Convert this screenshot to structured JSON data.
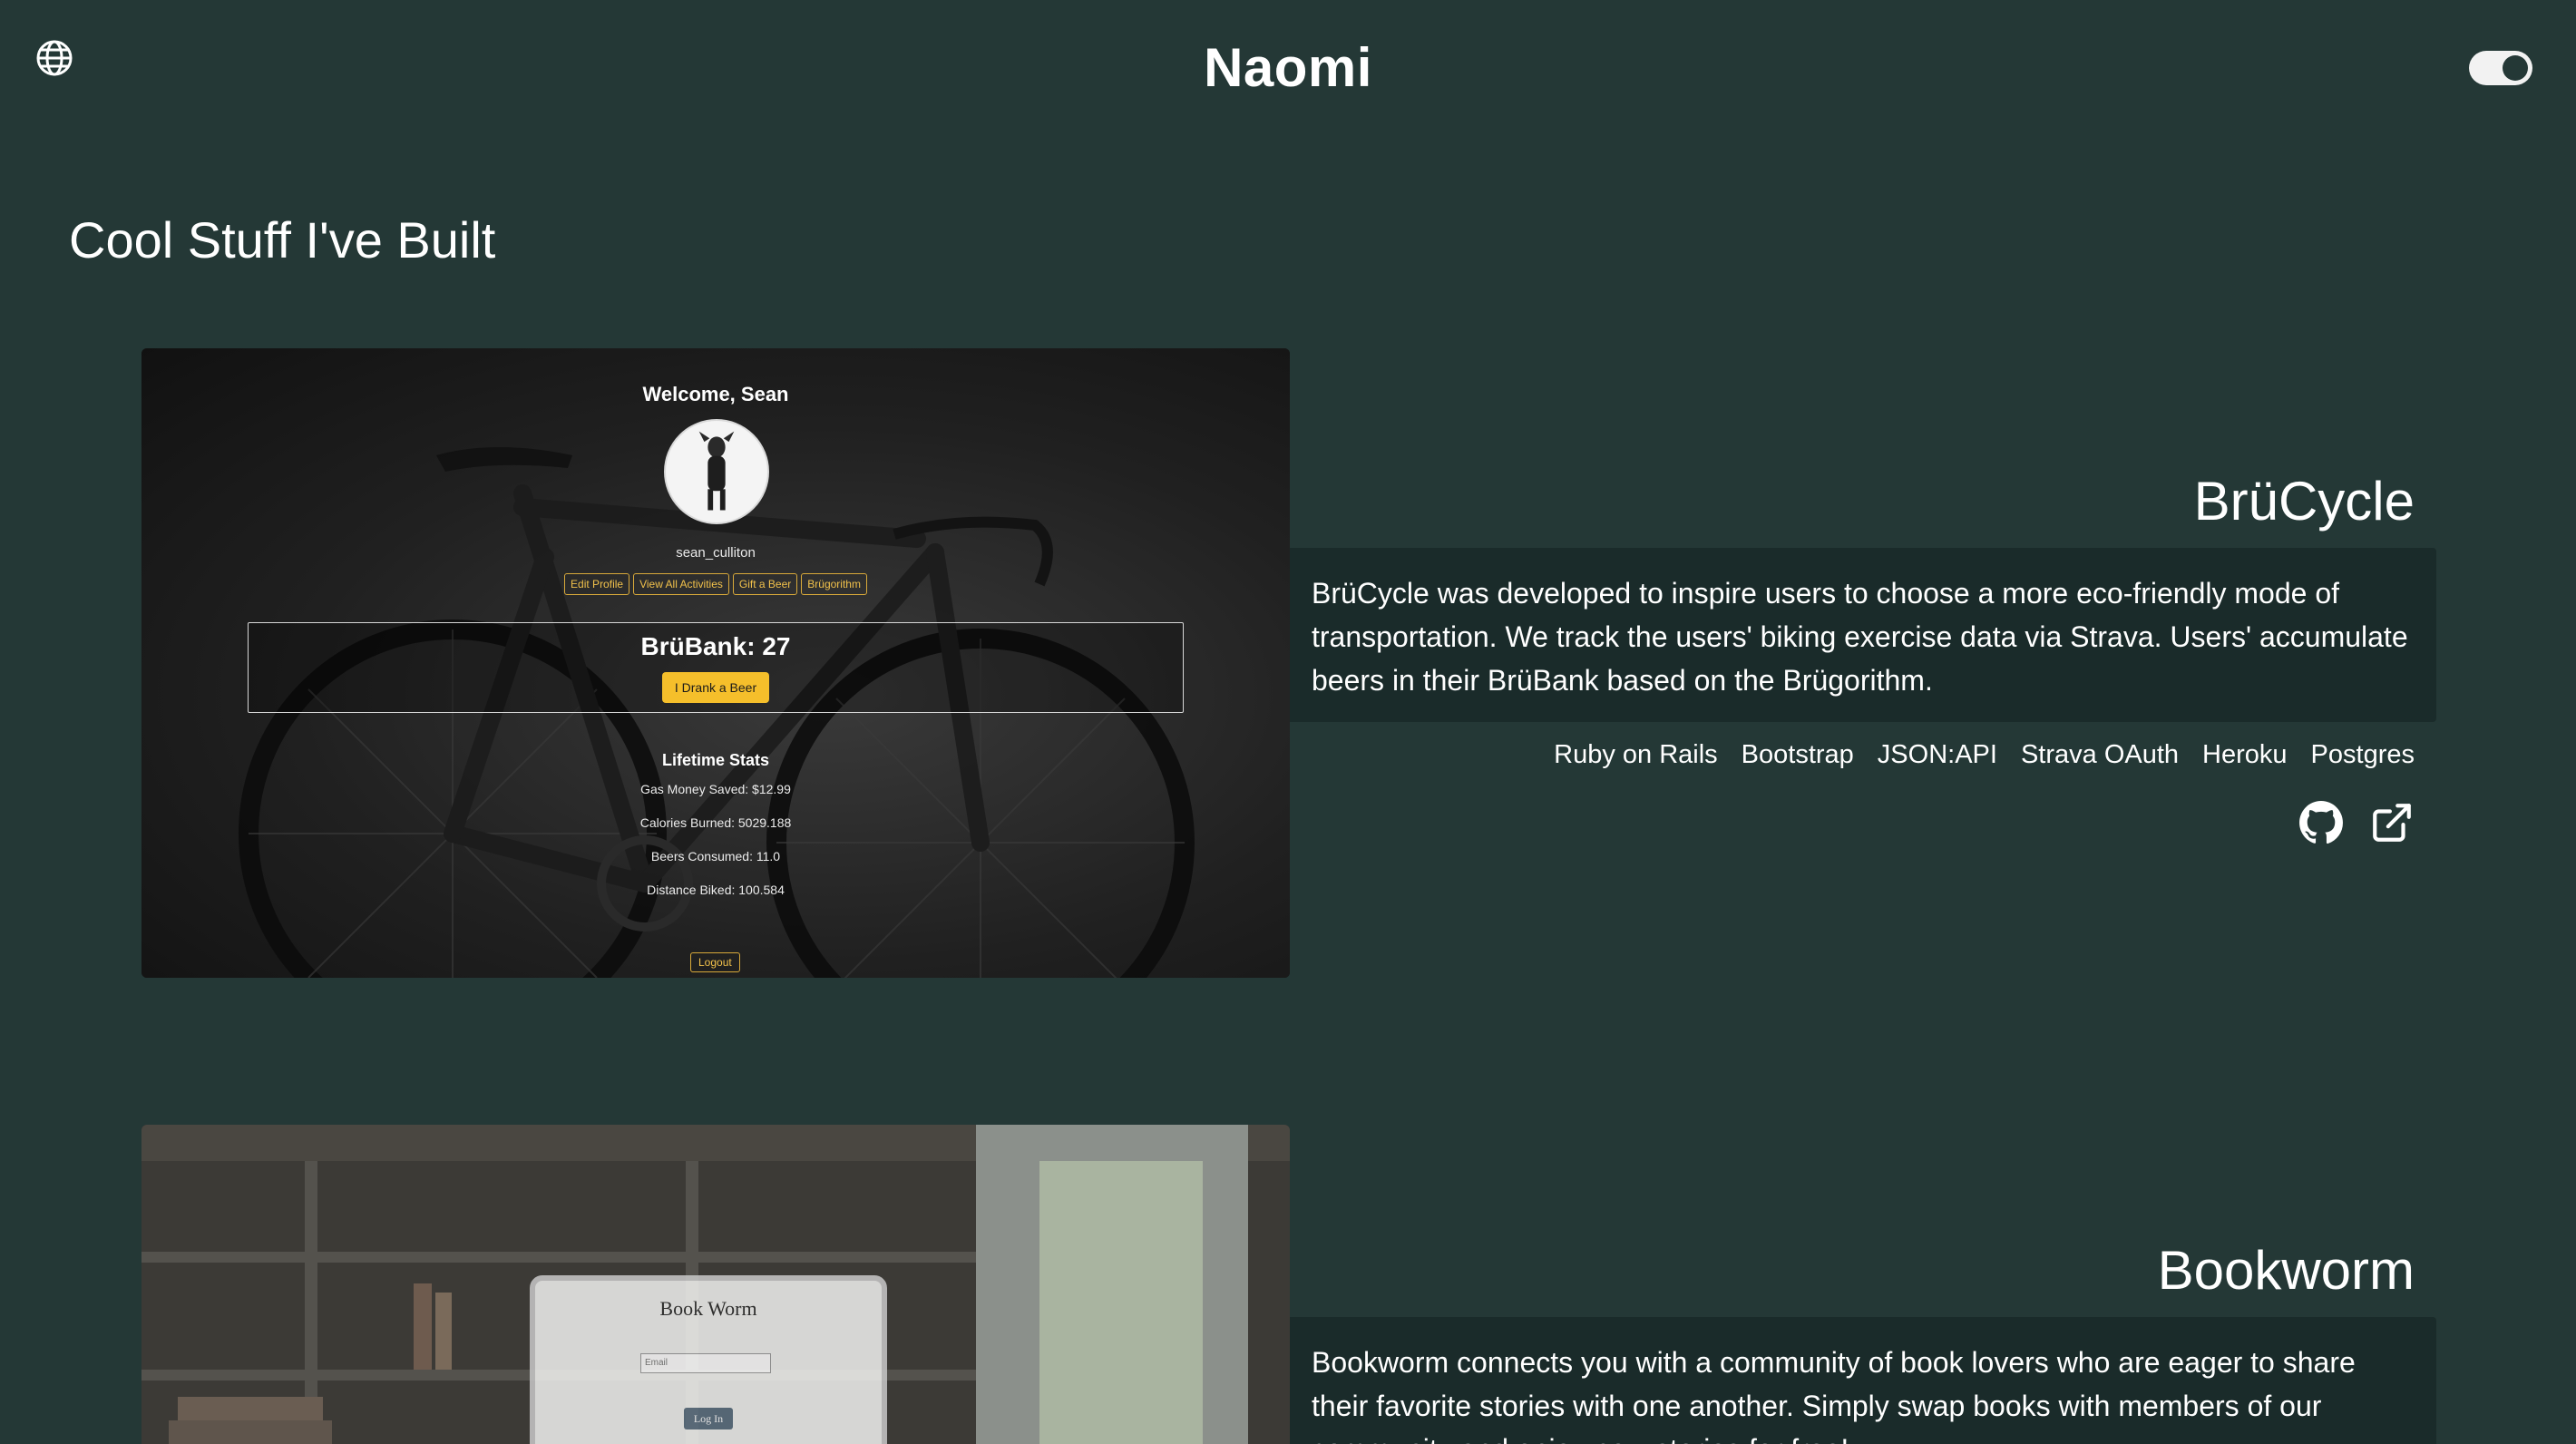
{
  "header": {
    "site_title": "Naomi",
    "globe_icon": "globe-icon",
    "toggle_icon": "theme-toggle"
  },
  "section_title": "Cool Stuff I've Built",
  "projects": [
    {
      "name": "BrüCycle",
      "description": "BrüCycle was developed to inspire users to choose a more eco-friendly mode of transportation. We track the users' biking exercise data via Strava. Users' accumulate beers in their BrüBank based on the Brügorithm.",
      "tech": [
        "Ruby on Rails",
        "Bootstrap",
        "JSON:API",
        "Strava OAuth",
        "Heroku",
        "Postgres"
      ],
      "links": [
        "github-icon",
        "external-link-icon"
      ],
      "screenshot": {
        "welcome": "Welcome, Sean",
        "username": "sean_culliton",
        "nav": [
          "Edit Profile",
          "View All Activities",
          "Gift a Beer",
          "Brügorithm"
        ],
        "bank_title": "BrüBank: 27",
        "bank_button": "I Drank a Beer",
        "stats_title": "Lifetime Stats",
        "stats": [
          "Gas Money Saved: $12.99",
          "Calories Burned: 5029.188",
          "Beers Consumed: 11.0",
          "Distance Biked: 100.584"
        ],
        "logout": "Logout"
      }
    },
    {
      "name": "Bookworm",
      "description": "Bookworm connects you with a community of book lovers who are eager to share their favorite stories with one another. Simply swap books with members of our community and enjoy new stories for free!",
      "screenshot": {
        "title": "Book Worm",
        "email_placeholder": "Email",
        "login": "Log In"
      }
    }
  ]
}
